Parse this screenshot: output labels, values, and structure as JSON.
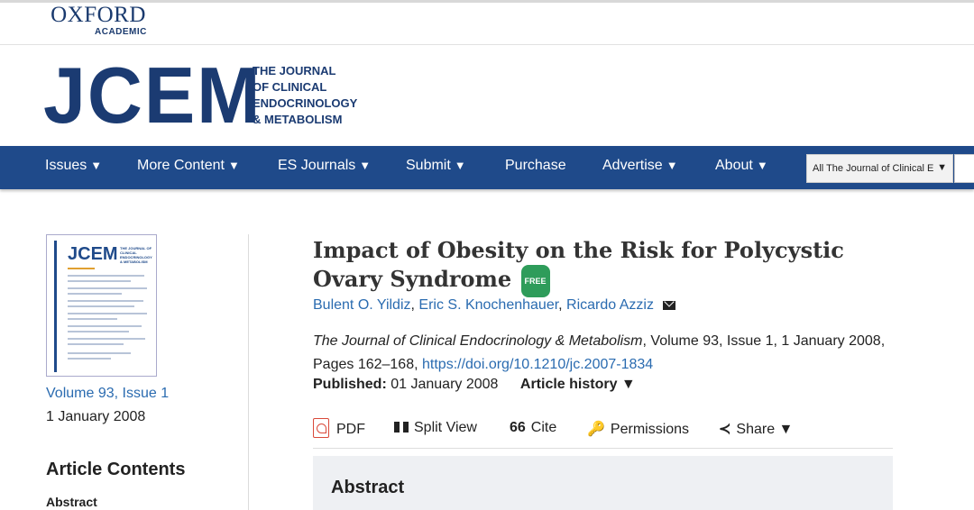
{
  "publisher": {
    "name": "OXFORD",
    "sub": "ACADEMIC"
  },
  "journal": {
    "logo": "JCEM",
    "tagline": [
      "THE JOURNAL",
      "OF CLINICAL",
      "ENDOCRINOLOGY",
      "& METABOLISM"
    ]
  },
  "nav": {
    "items": [
      {
        "label": "Issues",
        "caret": "▼"
      },
      {
        "label": "More Content",
        "caret": "▼"
      },
      {
        "label": "ES Journals",
        "caret": "▼"
      },
      {
        "label": "Submit",
        "caret": "▼"
      },
      {
        "label": "Purchase",
        "caret": ""
      },
      {
        "label": "Advertise",
        "caret": "▼"
      },
      {
        "label": "About",
        "caret": "▼"
      }
    ],
    "search_scope": "All The Journal of Clinical E",
    "search_caret": "▼"
  },
  "sidebar": {
    "cover_logo": "JCEM",
    "cover_sub": "THE JOURNAL OF CLINICAL ENDOCRINOLOGY & METABOLISM",
    "volume_link": "Volume 93, Issue 1",
    "issue_date": "1 January 2008",
    "contents_title": "Article Contents",
    "contents_items": [
      "Abstract"
    ]
  },
  "article": {
    "title": "Impact of Obesity on the Risk for Polycystic Ovary Syndrome",
    "badge": "FREE",
    "authors": [
      "Bulent O. Yildiz",
      "Eric S. Knochenhauer",
      "Ricardo Azziz"
    ],
    "citation_journal": "The Journal of Clinical Endocrinology & Metabolism",
    "citation_rest": ", Volume 93, Issue 1, 1 January 2008, Pages 162–168, ",
    "doi": "https://doi.org/10.1210/jc.2007-1834",
    "published_label": "Published:",
    "published_date": "01 January 2008",
    "history_label": "Article history ▼"
  },
  "toolbar": {
    "pdf": "PDF",
    "split_view": "Split View",
    "cite_icon": "66",
    "cite": "Cite",
    "permissions": "Permissions",
    "share": "Share ▼"
  },
  "abstract": {
    "title": "Abstract"
  },
  "colors": {
    "brand": "#1b3b72",
    "nav": "#1f4a8a",
    "link": "#2a6bb0",
    "free": "#2e9c5a"
  }
}
